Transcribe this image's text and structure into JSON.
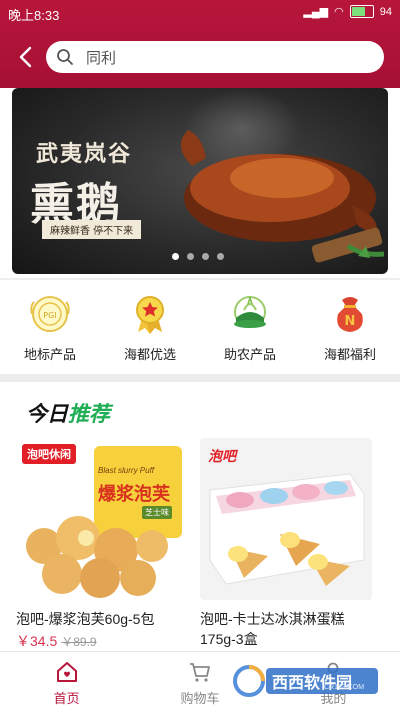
{
  "status_bar": {
    "time": "晚上8:33",
    "battery": "94"
  },
  "search": {
    "value": "同利"
  },
  "banner": {
    "line1": "武夷岚谷",
    "line2": "熏鹅",
    "line3": "麻辣鲜香 停不下来",
    "page_count": 4,
    "active_index": 1
  },
  "categories": [
    {
      "label": "地标产品",
      "icon": "landmark-badge-icon"
    },
    {
      "label": "海都优选",
      "icon": "medal-icon"
    },
    {
      "label": "助农产品",
      "icon": "farmer-icon"
    },
    {
      "label": "海都福利",
      "icon": "gift-bag-icon"
    }
  ],
  "section": {
    "title_part1": "今日",
    "title_part2": "推荐"
  },
  "products": [
    {
      "name": "泡吧-爆浆泡芙60g-5包",
      "price": "￥34.5",
      "old_price": "￥89.9",
      "brand": "泡吧休闲",
      "package_title": "爆浆泡芙",
      "package_sub": "Blast slurry Puff",
      "package_flavor": "芝士味"
    },
    {
      "name": "泡吧-卡士达冰淇淋蛋糕175g-3盒",
      "price": "",
      "old_price": "",
      "brand": "泡吧"
    }
  ],
  "tabs": [
    {
      "label": "首页",
      "active": true
    },
    {
      "label": "购物车",
      "active": false
    },
    {
      "label": "我的",
      "active": false
    }
  ],
  "watermark": {
    "text": "西西软件园",
    "sub": "CR173.COM"
  },
  "colors": {
    "brand": "#b8163b",
    "price": "#d8324f",
    "accent_green": "#1fae56"
  }
}
